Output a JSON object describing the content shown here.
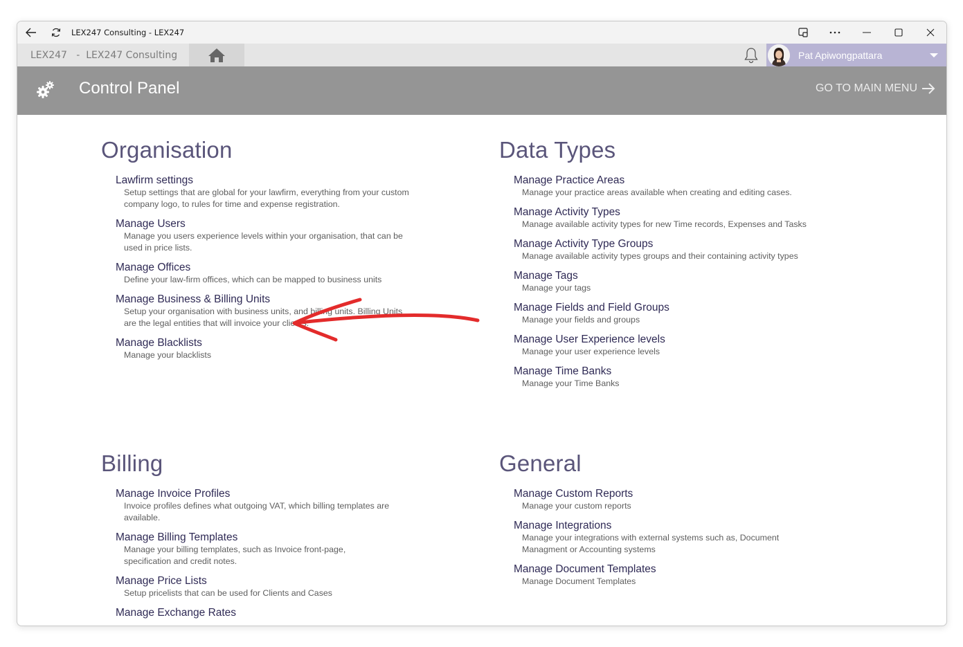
{
  "window": {
    "title": "LEX247 Consulting - LEX247"
  },
  "appbar": {
    "breadcrumb": "LEX247   -  LEX247 Consulting",
    "user_name": "Pat Apiwongpattara"
  },
  "header": {
    "title": "Control Panel",
    "main_menu_label": "GO TO MAIN MENU"
  },
  "sections": {
    "organisation": {
      "title": "Organisation",
      "items": [
        {
          "label": "Lawfirm settings",
          "desc": "Setup settings that are global for your lawfirm, everything from your custom company logo, to rules for time and expense registration."
        },
        {
          "label": "Manage Users",
          "desc": "Manage you users experience levels within your organisation, that can be used in price lists."
        },
        {
          "label": "Manage Offices",
          "desc": "Define your law-firm offices, which can be mapped to business units"
        },
        {
          "label": "Manage Business & Billing Units",
          "desc": "Setup your organisation with business units, and billing units. Billing Units are the legal entities that will invoice your clients."
        },
        {
          "label": "Manage Blacklists",
          "desc": "Manage your blacklists"
        }
      ]
    },
    "data_types": {
      "title": "Data Types",
      "items": [
        {
          "label": "Manage Practice Areas",
          "desc": "Manage your practice areas available when creating and editing cases."
        },
        {
          "label": "Manage Activity Types",
          "desc": "Manage available activity types for new Time records, Expenses and Tasks"
        },
        {
          "label": "Manage Activity Type Groups",
          "desc": "Manage available activity types groups and their containing activity types"
        },
        {
          "label": "Manage Tags",
          "desc": "Manage your tags"
        },
        {
          "label": "Manage Fields and Field Groups",
          "desc": "Manage your fields and groups"
        },
        {
          "label": "Manage User Experience levels",
          "desc": "Manage your user experience levels"
        },
        {
          "label": "Manage Time Banks",
          "desc": "Manage your Time Banks"
        }
      ]
    },
    "billing": {
      "title": "Billing",
      "items": [
        {
          "label": "Manage Invoice Profiles",
          "desc": "Invoice profiles defines what outgoing VAT, which billing templates are available."
        },
        {
          "label": "Manage Billing Templates",
          "desc": "Manage your billing templates, such as Invoice front-page, specification and credit notes."
        },
        {
          "label": "Manage Price Lists",
          "desc": "Setup pricelists that can be used for Clients and Cases"
        },
        {
          "label": "Manage Exchange Rates",
          "desc": ""
        }
      ]
    },
    "general": {
      "title": "General",
      "items": [
        {
          "label": "Manage Custom Reports",
          "desc": "Manage your custom reports"
        },
        {
          "label": "Manage Integrations",
          "desc": "Manage your integrations with external systems such as, Document Managment or Accounting systems"
        },
        {
          "label": "Manage Document Templates",
          "desc": "Manage Document Templates"
        }
      ]
    }
  },
  "colors": {
    "header_bg": "#959595",
    "user_bg": "#b8b4d4",
    "section_title": "#5a557a",
    "link": "#2f2a55",
    "annotation_arrow": "#e32b2b"
  },
  "icons": {
    "back": "back-arrow-icon",
    "refresh": "refresh-icon",
    "home": "home-icon",
    "bell": "bell-icon",
    "gear": "gears-icon",
    "arrow_right": "arrow-right-icon"
  }
}
